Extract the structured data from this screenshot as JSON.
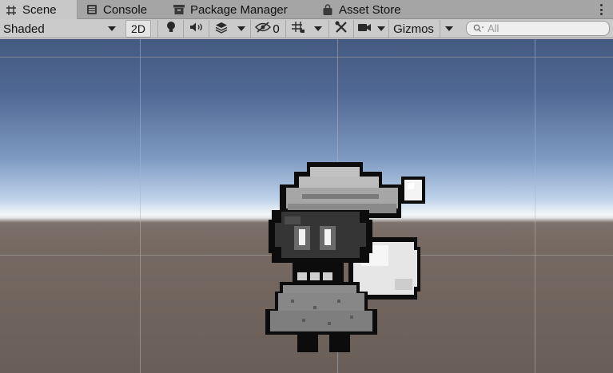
{
  "tabs": [
    {
      "label": "Scene",
      "icon": "scene-grid-icon",
      "active": true
    },
    {
      "label": "Console",
      "icon": "console-icon",
      "active": false
    },
    {
      "label": "Package Manager",
      "icon": "package-icon",
      "active": false
    },
    {
      "label": "Asset Store",
      "icon": "asset-store-bag-icon",
      "active": false
    }
  ],
  "toolbar": {
    "shading_mode": "Shaded",
    "mode_2d_label": "2D",
    "hidden_count": "0",
    "gizmos_label": "Gizmos",
    "search_placeholder": "All"
  },
  "colors": {
    "tab_bar": "#a5a5a5",
    "toolbar": "#cbcbcb",
    "sky_top": "#445a80",
    "horizon": "#f2f6f8",
    "ground": "#6a5e58"
  }
}
